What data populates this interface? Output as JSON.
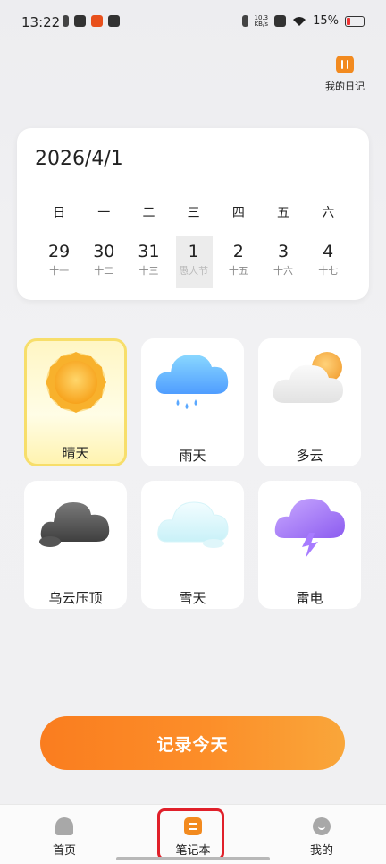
{
  "status_bar": {
    "time": "13:22",
    "network_speed_value": "10.3",
    "network_speed_unit": "KB/s",
    "battery": "15%",
    "battery_color": "#e53935"
  },
  "header": {
    "diary_label": "我的日记",
    "diary_icon": "pause-icon"
  },
  "calendar": {
    "date": "2026/4/1",
    "weekdays": [
      "日",
      "一",
      "二",
      "三",
      "四",
      "五",
      "六"
    ],
    "days": [
      {
        "day": "29",
        "lunar": "十一",
        "selected": false
      },
      {
        "day": "30",
        "lunar": "十二",
        "selected": false
      },
      {
        "day": "31",
        "lunar": "十三",
        "selected": false
      },
      {
        "day": "1",
        "lunar": "愚人节",
        "selected": true
      },
      {
        "day": "2",
        "lunar": "十五",
        "selected": false
      },
      {
        "day": "3",
        "lunar": "十六",
        "selected": false
      },
      {
        "day": "4",
        "lunar": "十七",
        "selected": false
      }
    ]
  },
  "weather_options": [
    {
      "label": "晴天",
      "icon": "sun-icon",
      "selected": true
    },
    {
      "label": "雨天",
      "icon": "rain-cloud-icon",
      "selected": false
    },
    {
      "label": "多云",
      "icon": "cloudy-icon",
      "selected": false
    },
    {
      "label": "乌云压顶",
      "icon": "dark-cloud-icon",
      "selected": false
    },
    {
      "label": "雪天",
      "icon": "snow-cloud-icon",
      "selected": false
    },
    {
      "label": "雷电",
      "icon": "thunder-cloud-icon",
      "selected": false
    }
  ],
  "record_button": {
    "label": "记录今天",
    "color": "#fa7d1f"
  },
  "bottom_nav": {
    "items": [
      {
        "label": "首页",
        "icon": "home-icon"
      },
      {
        "label": "笔记本",
        "icon": "notebook-icon"
      },
      {
        "label": "我的",
        "icon": "profile-icon"
      }
    ],
    "active_color": "#f28a1f",
    "highlight_color": "#e0202a"
  }
}
